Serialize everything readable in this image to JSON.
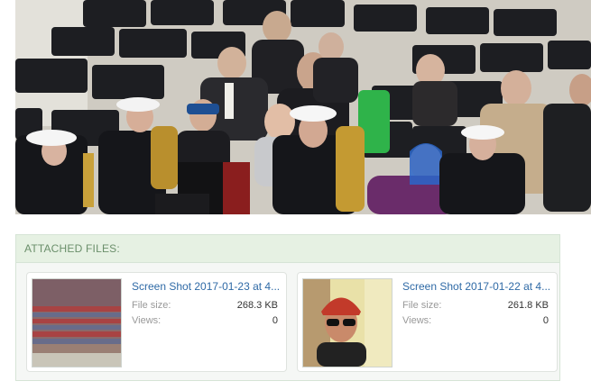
{
  "attachments": {
    "header": "ATTACHED FILES:",
    "files": [
      {
        "name": "Screen Shot 2017-01-23 at 4...",
        "size_label": "File size:",
        "size": "268.3 KB",
        "views_label": "Views:",
        "views": "0",
        "thumb_icon": "crowd-stadium-thumbnail"
      },
      {
        "name": "Screen Shot 2017-01-22 at 4...",
        "size_label": "File size:",
        "size": "261.8 KB",
        "views_label": "Views:",
        "views": "0",
        "thumb_icon": "person-selfie-thumbnail"
      }
    ]
  },
  "photo": {
    "icon": "inauguration-band-photo"
  },
  "colors": {
    "header_bg": "#e6f1e3",
    "header_text": "#6b8f6b",
    "link": "#2f6aa6",
    "panel_bg": "#f5f7f5"
  }
}
